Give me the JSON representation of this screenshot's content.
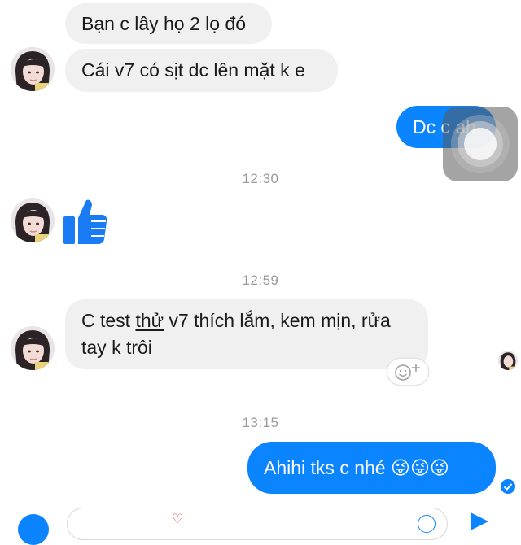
{
  "messages": {
    "m1": "Bạn c lây họ 2 lọ đó",
    "m2": "Cái v7 có sịt dc lên mặt k e",
    "m3": "Dc c ah",
    "m4_pre": "C test ",
    "m4_ul": "thử",
    "m4_post": " v7 thích lắm, kem mịn, rửa",
    "m4_line2": "tay k trôi",
    "m5": "Ahihi tks c nhé 😜😜😜"
  },
  "timestamps": {
    "t1": "12:30",
    "t2": "12:59",
    "t3": "13:15"
  },
  "colors": {
    "outgoing_bubble": "#0a84ff",
    "incoming_bubble": "#f0f0f0",
    "like_icon": "#1a7cf5"
  },
  "icons": [
    "like-thumb-icon",
    "add-reaction-icon",
    "delivered-check-icon",
    "camera-icon",
    "send-icon",
    "emoji-icon"
  ]
}
